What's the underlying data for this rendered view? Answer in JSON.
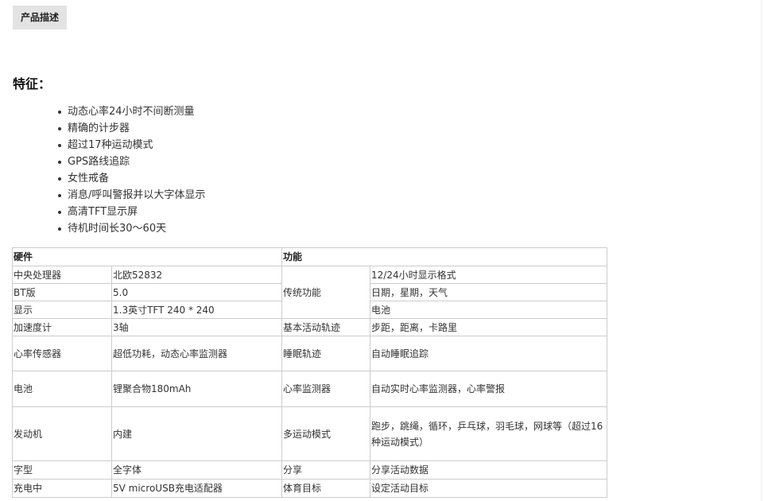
{
  "tab": {
    "label": "产品描述"
  },
  "features": {
    "title": "特征：",
    "items": [
      "动态心率24小时不间断测量",
      "精确的计步器",
      "超过17种运动模式",
      "GPS路线追踪",
      "女性戒备",
      "消息/呼叫警报并以大字体显示",
      "高清TFT显示屏",
      "待机时间长30～60天"
    ]
  },
  "spec_table": {
    "headers": {
      "hardware": "硬件",
      "function": "功能"
    },
    "rows": [
      {
        "hw_label": "中央处理器",
        "hw_value": "北欧52832",
        "fn_label": "传统功能",
        "fn_value": "12/24小时显示格式"
      },
      {
        "hw_label": "BT版",
        "hw_value": "5.0",
        "fn_value": "日期，星期，天气"
      },
      {
        "hw_label": "显示",
        "hw_value": "1.3英寸TFT 240 * 240",
        "fn_value": "电池"
      },
      {
        "hw_label": "加速度计",
        "hw_value": "3轴",
        "fn_label": "基本活动轨迹",
        "fn_value": "步距，距离，卡路里"
      },
      {
        "hw_label": "心率传感器",
        "hw_value": "超低功耗，动态心率监测器",
        "fn_label": "睡眠轨迹",
        "fn_value": "自动睡眠追踪"
      },
      {
        "hw_label": "电池",
        "hw_value": "锂聚合物180mAh",
        "fn_label": "心率监测器",
        "fn_value": "自动实时心率监测器，心率警报"
      },
      {
        "hw_label": "发动机",
        "hw_value": "内建",
        "fn_label": "多运动模式",
        "fn_value": "跑步，跳绳，循环，乒乓球，羽毛球，网球等（超过16种运动模式）"
      },
      {
        "hw_label": "字型",
        "hw_value": "全字体",
        "fn_label": "分享",
        "fn_value": "分享活动数据"
      },
      {
        "hw_label": "充电中",
        "hw_value": "5V microUSB充电适配器",
        "fn_label": "体育目标",
        "fn_value": "设定活动目标"
      }
    ]
  }
}
